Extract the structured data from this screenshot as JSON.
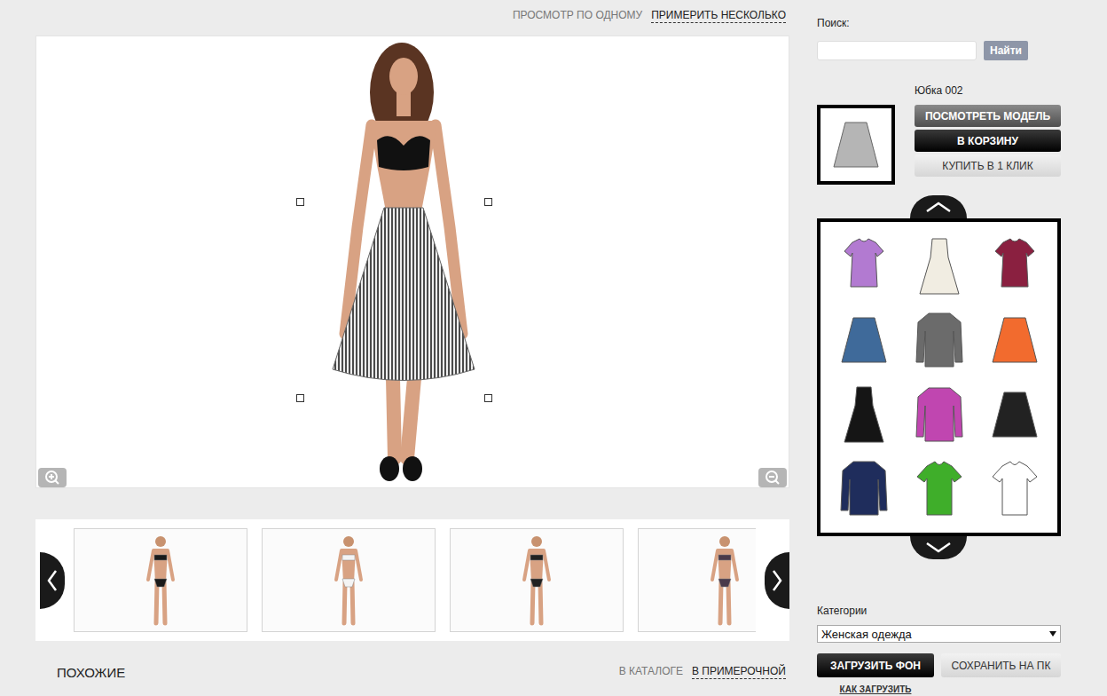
{
  "view_modes": [
    {
      "label": "ПРОСМОТР ПО ОДНОМУ",
      "selected": false
    },
    {
      "label": "ПРИМЕРИТЬ НЕСКОЛЬКО",
      "selected": true
    }
  ],
  "models": [
    {
      "color": "#1a1a1a"
    },
    {
      "color": "#f4f4f4"
    },
    {
      "color": "#222222"
    },
    {
      "color": "#4a3a4a"
    }
  ],
  "similar": {
    "title": "ПОХОЖИЕ",
    "tabs": [
      {
        "label": "В КАТАЛОГЕ",
        "selected": false
      },
      {
        "label": "В ПРИМЕРОЧНОЙ",
        "selected": true
      }
    ]
  },
  "search": {
    "label": "Поиск:",
    "value": "",
    "button": "Найти"
  },
  "product": {
    "name": "Юбка 002",
    "kind": "skirt",
    "color": "#b5b5b5",
    "buttons": [
      {
        "label": "ПОСМОТРЕТЬ МОДЕЛЬ",
        "kind": "grey"
      },
      {
        "label": "В КОРЗИНУ",
        "kind": "dark"
      },
      {
        "label": "КУПИТЬ В 1 КЛИК",
        "kind": "light"
      }
    ]
  },
  "garments": [
    {
      "kind": "blouse",
      "color": "#b27ad1"
    },
    {
      "kind": "dress",
      "color": "#f1ede2"
    },
    {
      "kind": "blouse",
      "color": "#8a2040"
    },
    {
      "kind": "skirt",
      "color": "#3f6a9a"
    },
    {
      "kind": "coat",
      "color": "#6b6b6b"
    },
    {
      "kind": "skirt",
      "color": "#f26b2e"
    },
    {
      "kind": "dress",
      "color": "#151515"
    },
    {
      "kind": "coat",
      "color": "#c046b0"
    },
    {
      "kind": "skirt",
      "color": "#222222"
    },
    {
      "kind": "coat",
      "color": "#1f2d5c"
    },
    {
      "kind": "tshirt",
      "color": "#3fae2a"
    },
    {
      "kind": "tshirt",
      "color": "#ffffff"
    }
  ],
  "categories": {
    "label": "Категории",
    "value": "Женская одежда"
  },
  "actions": [
    {
      "label": "ЗАГРУЗИТЬ ФОН",
      "kind": "dark"
    },
    {
      "label": "СОХРАНИТЬ НА ПК",
      "kind": "light"
    }
  ],
  "help_link": "КАК ЗАГРУЗИТЬ"
}
